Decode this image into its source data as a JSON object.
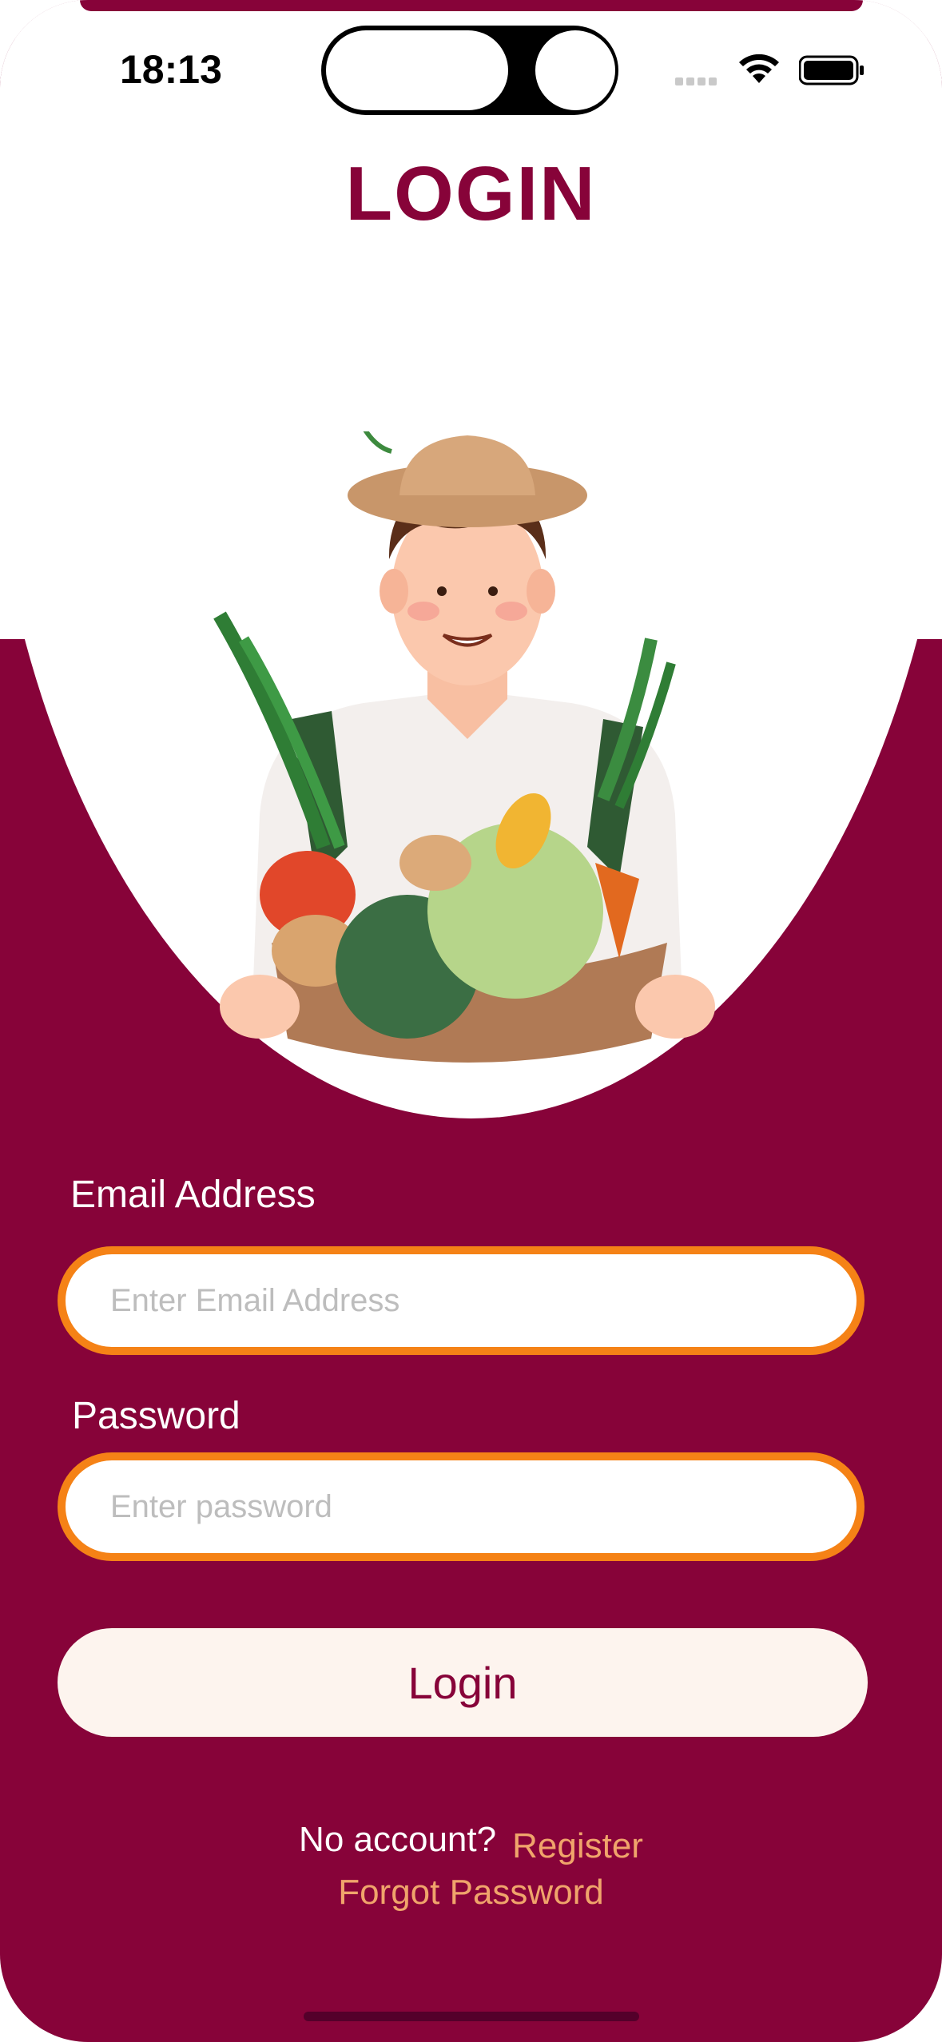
{
  "status_bar": {
    "time": "18:13",
    "icons": [
      "signal-icon",
      "wifi-icon",
      "battery-icon"
    ]
  },
  "header": {
    "title": "LOGIN"
  },
  "illustration": {
    "icon": "farmer-with-vegetable-basket-illustration"
  },
  "form": {
    "email_label": "Email Address",
    "email_placeholder": "Enter Email Address",
    "email_value": "",
    "password_label": "Password",
    "password_placeholder": "Enter password",
    "password_value": "",
    "login_button": "Login"
  },
  "footer": {
    "no_account_text": "No account?",
    "register_link": "Register",
    "forgot_password_link": "Forgot Password"
  },
  "colors": {
    "brand": "#870339",
    "input_border": "#f58216",
    "link": "#f0a46b",
    "button_bg": "#fdf4ee"
  }
}
